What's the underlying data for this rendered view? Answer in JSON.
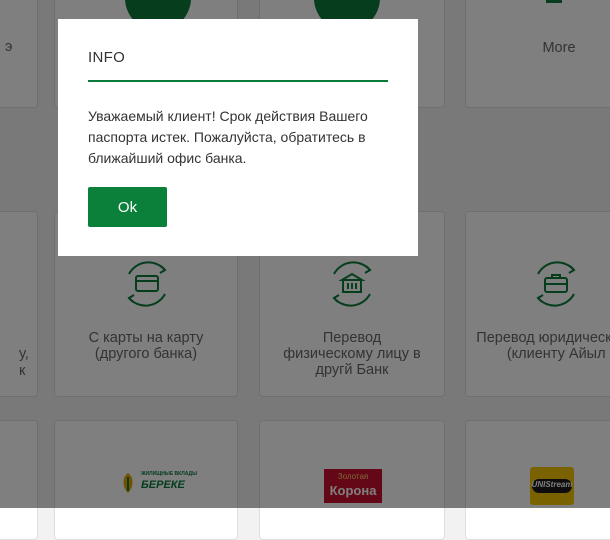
{
  "tiles": {
    "more_label": "More",
    "card_to_card_label": "С карты на карту (другого банка)",
    "transfer_individual_label": "Перевод физическому лицу в другй Банк",
    "transfer_legal_label": "Перевод юридическому ли (клиенту Айыл Ба",
    "left_partial_row1": "э",
    "left_partial_row2_a": "у,",
    "left_partial_row2_b": "к"
  },
  "logos": {
    "bereke": "БЕРЕКЕ",
    "bereke_small": "ЖИЛИЩНЫЕ ВКЛАДЫ",
    "zolotaya_top": "Золотая",
    "zolotaya_bottom": "Корона",
    "unistream": "UNIStream"
  },
  "modal": {
    "title": "INFO",
    "message": "Уважаемый клиент! Срок действия Вашего паспорта истек. Пожалуйста, обратитесь в ближайший офис банка.",
    "ok_label": "Ok"
  },
  "colors": {
    "brand_green": "#0a803b",
    "overlay": "rgba(0,0,0,0.5)",
    "zolotaya_red": "#c8102e",
    "unistream_yellow": "#f5c400"
  }
}
